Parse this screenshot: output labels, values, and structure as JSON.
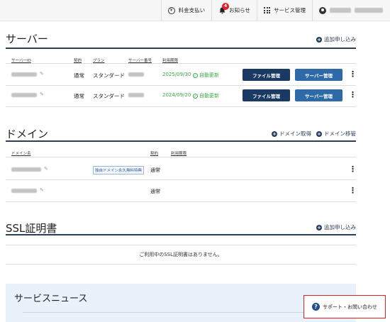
{
  "header": {
    "billing_label": "料金支払い",
    "billing_icon": "yen-icon",
    "notifications_label": "お知らせ",
    "notifications_badge": "4",
    "service_mgmt_label": "サービス管理",
    "user_icon": "user-icon"
  },
  "servers": {
    "title": "サーバー",
    "add_label": "追加申し込み",
    "columns": [
      "サーバーID",
      "契約",
      "プラン",
      "サーバー番号",
      "利用期限"
    ],
    "rows": [
      {
        "contract": "通常",
        "plan": "スタンダード",
        "expiry": "2025/09/30",
        "renew": "自動更新",
        "file_btn": "ファイル管理",
        "server_btn": "サーバー管理"
      },
      {
        "contract": "通常",
        "plan": "スタンダード",
        "expiry": "2024/09/20",
        "renew": "自動更新",
        "file_btn": "ファイル管理",
        "server_btn": "サーバー管理"
      }
    ]
  },
  "domains": {
    "title": "ドメイン",
    "acquire_label": "ドメイン取得",
    "transfer_label": "ドメイン移管",
    "columns": [
      "ドメイン名",
      "契約",
      "利用期限"
    ],
    "rows": [
      {
        "tag": "独自ドメイン永久無料特典",
        "contract": "通常"
      },
      {
        "tag": "",
        "contract": "通常"
      }
    ]
  },
  "ssl": {
    "title": "SSL証明書",
    "add_label": "追加申し込み",
    "empty_message": "ご利用中のSSL証明書はありません。"
  },
  "news": {
    "title": "サービスニュース"
  },
  "support": {
    "label": "サポート・お問い合わせ",
    "icon": "question-icon",
    "highlight_color": "#e02020"
  }
}
